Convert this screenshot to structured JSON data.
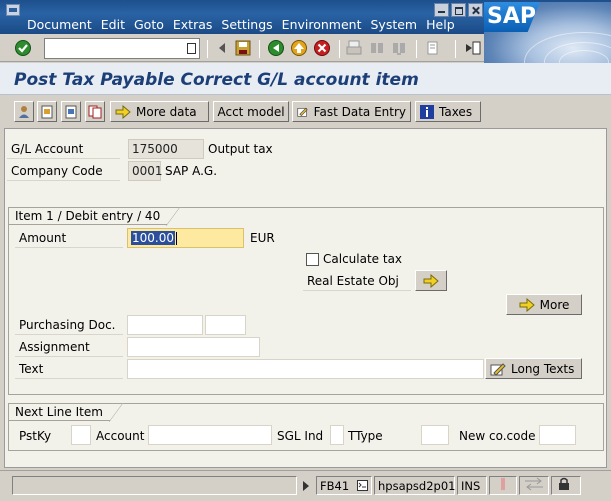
{
  "menu": [
    "Document",
    "Edit",
    "Goto",
    "Extras",
    "Settings",
    "Environment",
    "System",
    "Help"
  ],
  "logo_text": "SAP",
  "command_field": {
    "value": ""
  },
  "page_title": "Post Tax Payable Correct G/L account item",
  "app_toolbar": {
    "more_data": "More data",
    "acct_model": "Acct model",
    "fast_data_entry": "Fast Data Entry",
    "taxes": "Taxes"
  },
  "header": {
    "gl_account_label": "G/L Account",
    "gl_account_value": "175000",
    "gl_account_text": "Output tax",
    "company_code_label": "Company Code",
    "company_code_value": "0001",
    "company_code_text": "SAP A.G."
  },
  "item": {
    "group_title": "Item 1 / Debit entry / 40",
    "amount_label": "Amount",
    "amount_value": "100.00",
    "currency": "EUR",
    "calculate_tax_label": "Calculate tax",
    "calculate_tax_checked": false,
    "real_estate_label": "Real Estate Obj",
    "more_label": "More",
    "purchasing_doc_label": "Purchasing Doc.",
    "purchasing_doc_value": "",
    "purchasing_doc_item": "",
    "assignment_label": "Assignment",
    "assignment_value": "",
    "text_label": "Text",
    "text_value": "",
    "long_texts_label": "Long Texts"
  },
  "next_line": {
    "group_title": "Next Line Item",
    "pstky_label": "PstKy",
    "pstky_value": "",
    "account_label": "Account",
    "account_value": "",
    "sgl_label": "SGL Ind",
    "sgl_value": "",
    "ttype_label": "TType",
    "ttype_value": "",
    "newcc_label": "New co.code",
    "newcc_value": ""
  },
  "status_bar": {
    "transaction": "FB41",
    "server": "hpsapsd2p01",
    "mode": "INS"
  },
  "colors": {
    "accent_blue": "#1c3f78",
    "active_field": "#fde9a0",
    "selection": "#2b4f9c"
  }
}
